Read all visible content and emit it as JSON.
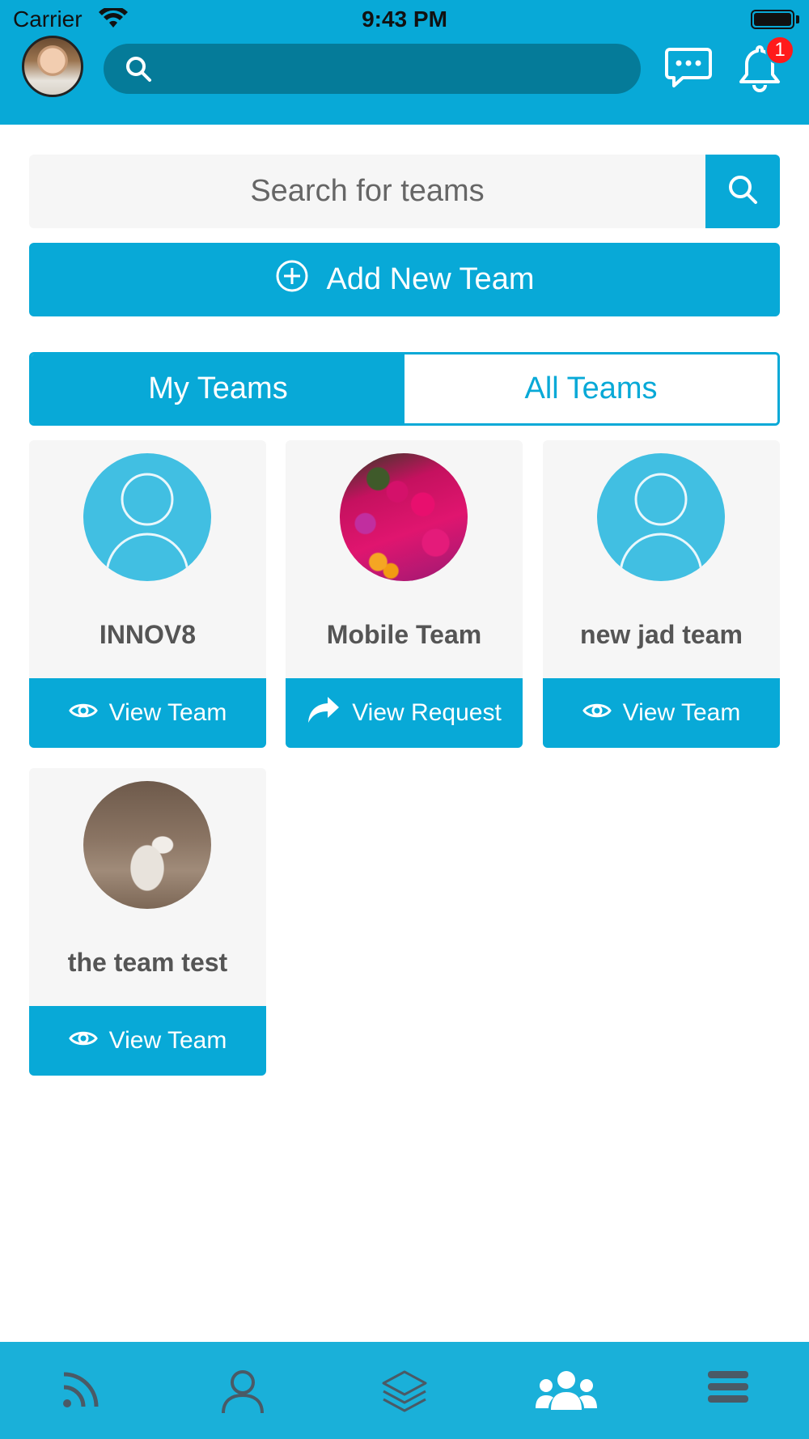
{
  "status_bar": {
    "carrier": "Carrier",
    "time": "9:43 PM"
  },
  "header": {
    "search_placeholder": "",
    "notifications_count": "1"
  },
  "team_search": {
    "placeholder": "Search for teams"
  },
  "add_team": {
    "label": "Add New Team"
  },
  "tabs": [
    {
      "label": "My Teams",
      "active": true
    },
    {
      "label": "All Teams",
      "active": false
    }
  ],
  "teams": [
    {
      "name": "INNOV8",
      "image": "default-avatar",
      "button": "View Team",
      "button_icon": "eye-icon"
    },
    {
      "name": "Mobile Team",
      "image": "flowers-photo",
      "button": "View Request",
      "button_icon": "share-arrow-icon"
    },
    {
      "name": "new jad team",
      "image": "default-avatar",
      "button": "View Team",
      "button_icon": "eye-icon"
    },
    {
      "name": "the team test",
      "image": "dog-photo",
      "button": "View Team",
      "button_icon": "eye-icon"
    }
  ],
  "bottom_nav": [
    {
      "icon": "feed-icon",
      "active": false
    },
    {
      "icon": "profile-icon",
      "active": false
    },
    {
      "icon": "layers-icon",
      "active": false
    },
    {
      "icon": "teams-icon",
      "active": true
    },
    {
      "icon": "menu-icon",
      "active": false
    }
  ],
  "colors": {
    "primary": "#08a9d7",
    "header_search": "#057b99",
    "card_background": "#f6f6f6",
    "badge": "#ff1b1b",
    "nav_inactive": "#4a5a66"
  }
}
